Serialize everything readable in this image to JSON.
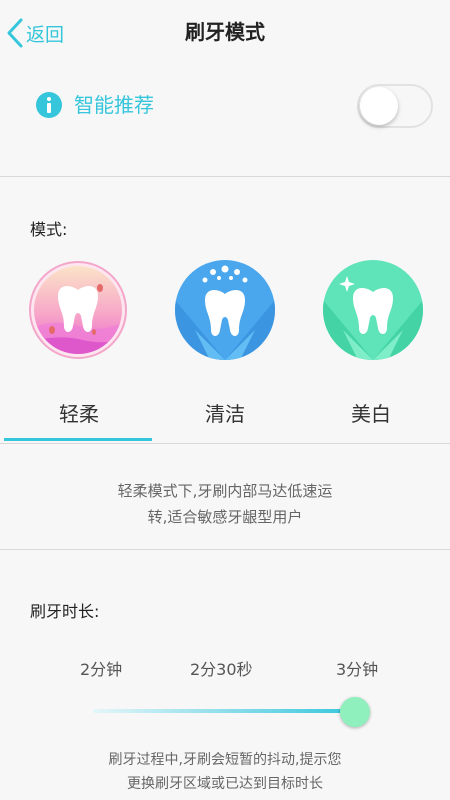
{
  "nav": {
    "back_label": "返回",
    "title": "刷牙模式"
  },
  "smart": {
    "label": "智能推荐",
    "icon": "info-icon",
    "enabled": false
  },
  "mode_section": {
    "label": "模式:",
    "modes": [
      {
        "name": "轻柔",
        "icon": "gentle-tooth-icon",
        "selected": true
      },
      {
        "name": "清洁",
        "icon": "clean-tooth-icon",
        "selected": false
      },
      {
        "name": "美白",
        "icon": "whitening-tooth-icon",
        "selected": false
      }
    ],
    "description_line1": "轻柔模式下,牙刷内部马达低速运",
    "description_line2": "转,适合敏感牙龈型用户"
  },
  "duration_section": {
    "label": "刷牙时长:",
    "options": [
      "2分钟",
      "2分30秒",
      "3分钟"
    ],
    "selected_index": 2,
    "note_line1": "刷牙过程中,牙刷会短暂的抖动,提示您",
    "note_line2": "更换刷牙区域或已达到目标时长"
  },
  "colors": {
    "accent": "#36c6dc",
    "slider_thumb": "#8ff0bd"
  }
}
